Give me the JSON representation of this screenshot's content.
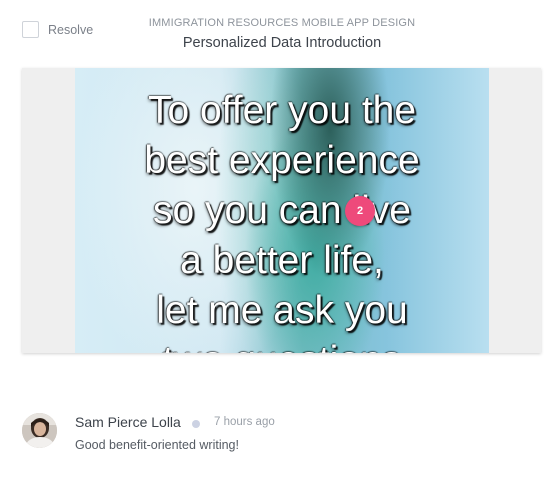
{
  "header": {
    "resolve_label": "Resolve",
    "project_name": "IMMIGRATION RESOURCES MOBILE APP DESIGN",
    "screen_title": "Personalized Data Introduction"
  },
  "preview": {
    "image_text": "To offer you the\nbest experience\nso you can live\na better life,\nlet me ask you\ntwo questions",
    "pin_number": "2",
    "pin_color": "#ee4a7b"
  },
  "comment": {
    "author": "Sam Pierce Lolla",
    "time": "7 hours ago",
    "text": "Good benefit-oriented writing!",
    "avatar": "user-avatar"
  }
}
